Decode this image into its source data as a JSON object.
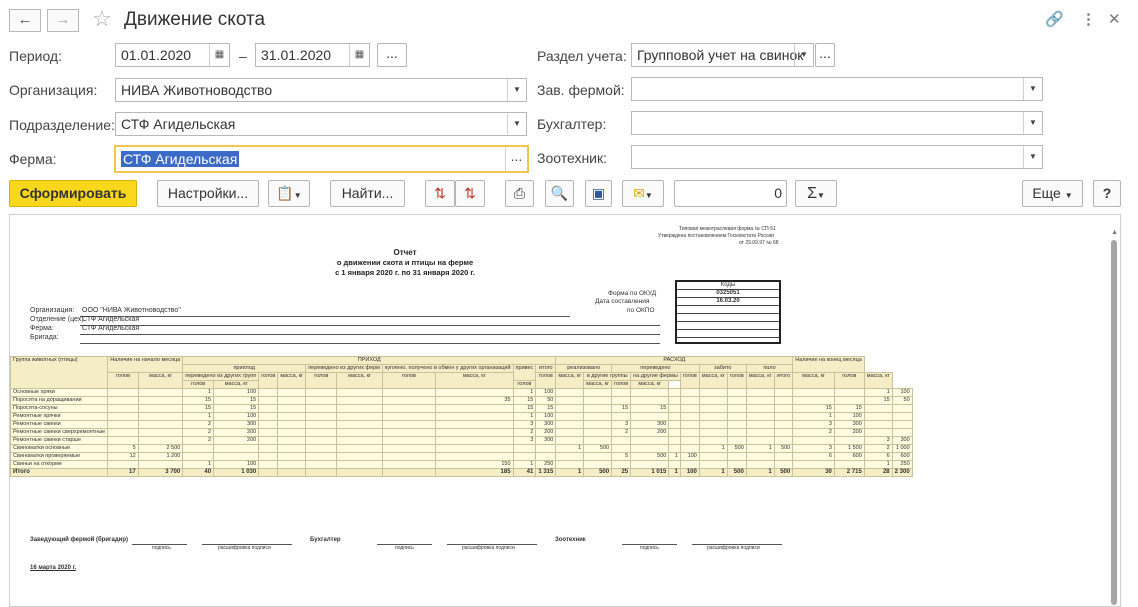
{
  "window": {
    "title": "Движение скота"
  },
  "form": {
    "period_label": "Период:",
    "period_from": "01.01.2020",
    "period_dash": "–",
    "period_to": "31.01.2020",
    "dots": "...",
    "org_label": "Организация:",
    "org_value": "НИВА Животноводство",
    "dept_label": "Подразделение:",
    "dept_value": "СТФ Агидельская",
    "farm_label": "Ферма:",
    "farm_value": "СТФ Агидельская",
    "section_label": "Раздел учета:",
    "section_value": "Групповой учет на свинок",
    "farm_manager_label": "Зав. фермой:",
    "accountant_label": "Бухгалтер:",
    "zootech_label": "Зоотехник:"
  },
  "toolbar": {
    "generate": "Сформировать",
    "settings": "Настройки...",
    "find": "Найти...",
    "sum_value": "0",
    "more": "Еще",
    "help": "?"
  },
  "report": {
    "form_note1": "Типовая межотраслевая форма № СП-51",
    "form_note2": "Утверждена постановлением Госкомстата России",
    "form_note3": "от 29.09.97 № 68",
    "title1": "Отчет",
    "title2": "о движении скота и птицы на ферме",
    "title3": "с 1 января 2020 г. по 31 января 2020 г.",
    "codes_header": "Коды",
    "okud_label": "Форма по ОКУД",
    "okud_value": "0325051",
    "date_label": "Дата составления",
    "date_value": "16.03.20",
    "okpo_label": "по ОКПО",
    "org_label": "Организация:",
    "org_value": "ООО \"НИВА Животноводство\"",
    "dept_label": "Отделение (цех)",
    "dept_value": "СТФ Агидельская",
    "farm_label": "Ферма:",
    "farm_value": "СТФ Агидельская",
    "brigade_label": "Бригада:",
    "headers": {
      "group": "Группа животных (птицы)",
      "start": "Наличие на начало месяца",
      "income": "ПРИХОД",
      "expense": "РАСХОД",
      "end": "Наличие на конец месяца",
      "heads": "голов",
      "mass": "масса, кг",
      "offspring": "приплод",
      "moved_from_groups": "переведено из других групп",
      "moved_from_farms": "переведено из других ферм",
      "bought": "куплено, получено в обмен у других организаций",
      "gain": "привес",
      "total": "итого",
      "sold": "реализовано",
      "moved": "переведено",
      "to_groups": "в другие группы",
      "to_farms": "на другие фермы",
      "slaughtered": "забито",
      "fallen": "пало"
    },
    "rows": [
      {
        "name": "Основные хряки",
        "c": [
          "",
          "",
          "1",
          "100",
          "",
          "",
          "",
          "",
          "",
          "",
          "1",
          "100",
          "",
          "",
          "",
          "",
          "",
          "",
          "",
          "",
          "",
          "",
          "",
          "",
          "1",
          "100"
        ]
      },
      {
        "name": "Поросята на доращивании",
        "c": [
          "",
          "",
          "15",
          "15",
          "",
          "",
          "",
          "",
          "",
          "35",
          "15",
          "50",
          "",
          "",
          "",
          "",
          "",
          "",
          "",
          "",
          "",
          "",
          "",
          "",
          "15",
          "50"
        ]
      },
      {
        "name": "Поросята-сосуны",
        "c": [
          "",
          "",
          "15",
          "15",
          "",
          "",
          "",
          "",
          "",
          "",
          "15",
          "15",
          "",
          "",
          "15",
          "15",
          "",
          "",
          "",
          "",
          "",
          "",
          "15",
          "15",
          "",
          ""
        ]
      },
      {
        "name": "Ремонтные хрячки",
        "c": [
          "",
          "",
          "1",
          "100",
          "",
          "",
          "",
          "",
          "",
          "",
          "1",
          "100",
          "",
          "",
          "",
          "",
          "",
          "",
          "",
          "",
          "",
          "",
          "1",
          "100",
          "",
          ""
        ]
      },
      {
        "name": "Ремонтные свинки",
        "c": [
          "",
          "",
          "2",
          "300",
          "",
          "",
          "",
          "",
          "",
          "",
          "3",
          "300",
          "",
          "",
          "3",
          "300",
          "",
          "",
          "",
          "",
          "",
          "",
          "3",
          "300",
          "",
          ""
        ]
      },
      {
        "name": "Ремонтные свинки сверхремонтные",
        "c": [
          "",
          "",
          "2",
          "200",
          "",
          "",
          "",
          "",
          "",
          "",
          "2",
          "200",
          "",
          "",
          "2",
          "200",
          "",
          "",
          "",
          "",
          "",
          "",
          "2",
          "200",
          "",
          ""
        ]
      },
      {
        "name": "Ремонтные свинки старше",
        "c": [
          "",
          "",
          "2",
          "200",
          "",
          "",
          "",
          "",
          "",
          "",
          "3",
          "300",
          "",
          "",
          "",
          "",
          "",
          "",
          "",
          "",
          "",
          "",
          "",
          "",
          "3",
          "300"
        ]
      },
      {
        "name": "Свиноматки основные",
        "c": [
          "5",
          "2 500",
          "",
          "",
          "",
          "",
          "",
          "",
          "",
          "",
          "",
          "",
          "1",
          "500",
          "",
          "",
          "",
          "",
          "1",
          "500",
          "1",
          "500",
          "3",
          "1 500",
          "2",
          "1 000"
        ]
      },
      {
        "name": "Свиноматки проверяемые",
        "c": [
          "12",
          "1 200",
          "",
          "",
          "",
          "",
          "",
          "",
          "",
          "",
          "",
          "",
          "",
          "",
          "5",
          "500",
          "1",
          "100",
          "",
          "",
          "",
          "",
          "6",
          "600",
          "6",
          "600"
        ]
      },
      {
        "name": "Свиньи на откорме",
        "c": [
          "",
          "",
          "1",
          "100",
          "",
          "",
          "",
          "",
          "",
          "150",
          "1",
          "250",
          "",
          "",
          "",
          "",
          "",
          "",
          "",
          "",
          "",
          "",
          "",
          "",
          "1",
          "250"
        ]
      }
    ],
    "total": {
      "name": "Итого",
      "c": [
        "17",
        "3 700",
        "40",
        "1 030",
        "",
        "",
        "",
        "",
        "",
        "185",
        "41",
        "1 315",
        "1",
        "500",
        "25",
        "1 015",
        "1",
        "100",
        "1",
        "500",
        "1",
        "500",
        "30",
        "2 715",
        "28",
        "2 300"
      ]
    },
    "sign_manager": "Заведующий фермой (бригадир)",
    "sign_accountant": "Бухгалтер",
    "sign_zootech": "Зоотехник",
    "sign_caption": "подпись",
    "sign_decode": "расшифровка подписи",
    "sign_date": "16 марта 2020 г."
  }
}
